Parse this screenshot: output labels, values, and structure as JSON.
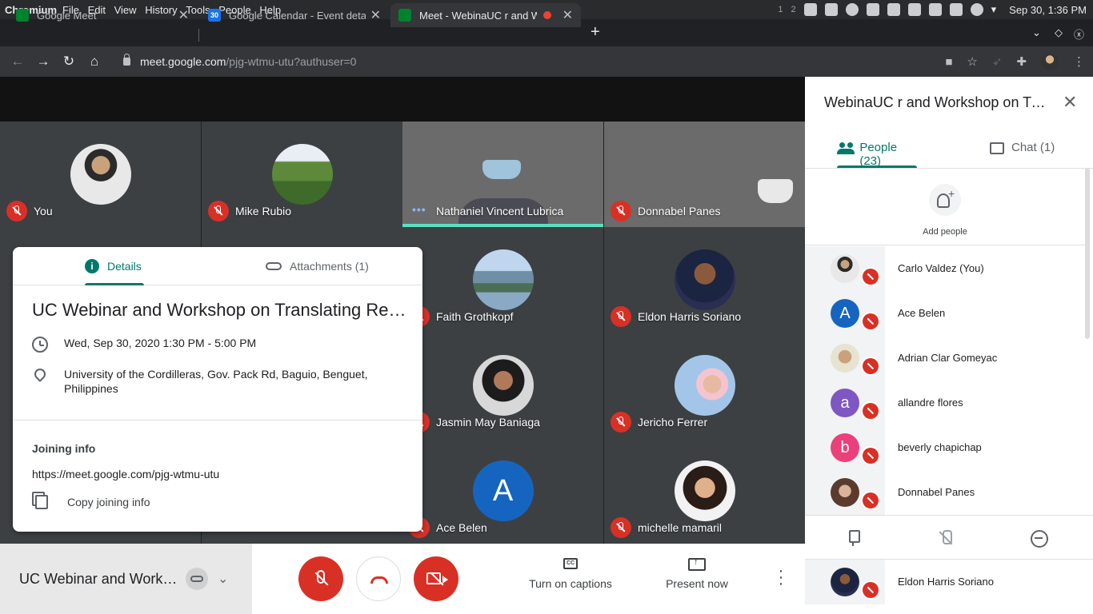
{
  "os": {
    "app_name": "Chromium",
    "menu": [
      "File",
      "Edit",
      "View",
      "History",
      "Tools",
      "People",
      "Help"
    ],
    "workspaces": [
      "1",
      "2"
    ],
    "clock": "Sep 30, 1:36 PM"
  },
  "tabs": [
    {
      "title": "Google Meet",
      "favicon": "meet-icon"
    },
    {
      "title": "Google Calendar - Event details",
      "favicon": "calendar-icon",
      "badge": "30"
    },
    {
      "title": "Meet - WebinaUC r and Workshop on Translating",
      "favicon": "meet-icon",
      "recording": true
    }
  ],
  "address": {
    "host": "meet.google.com",
    "path": "/pjg-wtmu-utu?authuser=0"
  },
  "tiles": [
    {
      "name": "You",
      "type": "avatar"
    },
    {
      "name": "Mike Rubio",
      "type": "avatar"
    },
    {
      "name": "Nathaniel Vincent Lubrica",
      "type": "video",
      "speaking": true
    },
    {
      "name": "Donnabel Panes",
      "type": "video"
    },
    {
      "name": "Faith Grothkopf",
      "type": "avatar"
    },
    {
      "name": "Eldon Harris Soriano",
      "type": "avatar"
    },
    {
      "name": "Jasmin May Baniaga",
      "type": "avatar"
    },
    {
      "name": "Jericho Ferrer",
      "type": "avatar"
    },
    {
      "name": "Ace Belen",
      "type": "letter",
      "letter": "A"
    },
    {
      "name": "michelle mamaril",
      "type": "avatar"
    }
  ],
  "details": {
    "tab_details": "Details",
    "tab_attachments": "Attachments (1)",
    "title": "UC Webinar and Workshop on Translating Res...",
    "datetime": "Wed, Sep 30, 2020 1:30 PM - 5:00 PM",
    "location": "University of the Cordilleras, Gov. Pack Rd, Baguio, Benguet, Philippines",
    "joining_heading": "Joining info",
    "joining_url": "https://meet.google.com/pjg-wtmu-utu",
    "copy_label": "Copy joining info"
  },
  "controls": {
    "meeting_title": "UC Webinar and Works...",
    "captions_label": "Turn on captions",
    "captions_glyph": "CC",
    "present_label": "Present now"
  },
  "panel": {
    "title": "WebinaUC r and Workshop on Translating",
    "people_tab": "People (23)",
    "chat_tab": "Chat (1)",
    "add_people": "Add people",
    "people": [
      {
        "name": "Carlo Valdez (You)",
        "avatar": "photo"
      },
      {
        "name": "Ace Belen",
        "letter": "A",
        "color": "#1565c0"
      },
      {
        "name": "Adrian Clar Gomeyac",
        "avatar": "photo"
      },
      {
        "name": "allandre flores",
        "letter": "a",
        "color": "#7e57c2"
      },
      {
        "name": "beverly chapichap",
        "letter": "b",
        "color": "#ec407a"
      },
      {
        "name": "Donnabel Panes",
        "avatar": "photo"
      }
    ],
    "bottom_person": {
      "name": "Eldon Harris Soriano",
      "avatar": "photo"
    }
  }
}
